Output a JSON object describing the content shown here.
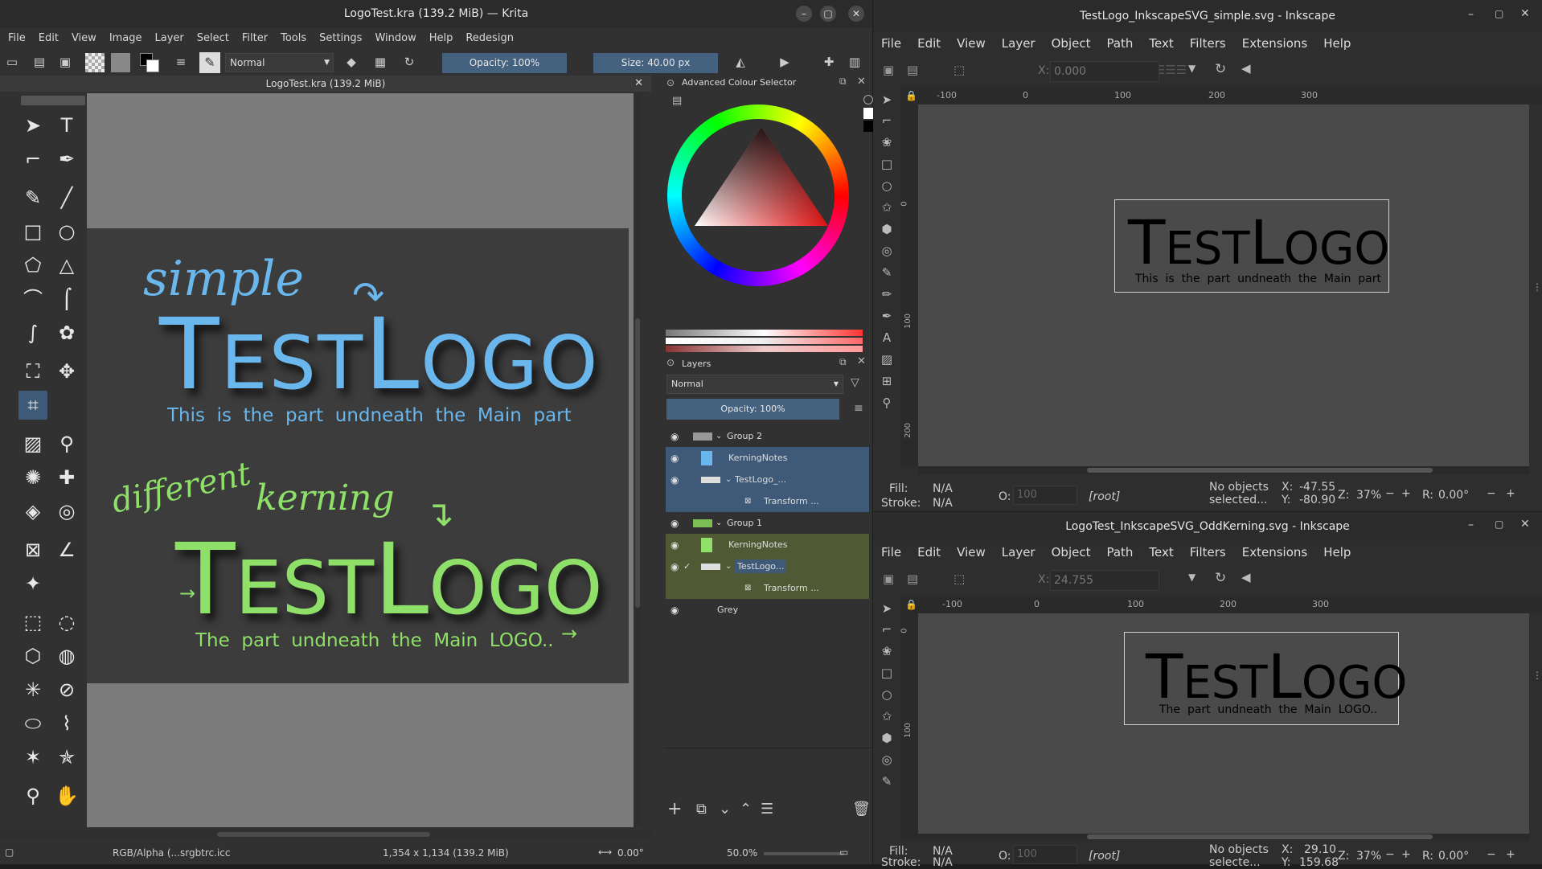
{
  "krita": {
    "title": "LogoTest.kra (139.2 MiB) — Krita",
    "menu": [
      "File",
      "Edit",
      "View",
      "Image",
      "Layer",
      "Select",
      "Filter",
      "Tools",
      "Settings",
      "Window",
      "Help",
      "Redesign"
    ],
    "blend_mode": "Normal",
    "opacity": "Opacity: 100%",
    "size": "Size: 40.00 px",
    "doc_tab": "LogoTest.kra (139.2 MiB)",
    "canvas": {
      "annot1": "simple",
      "logo1": "TESTLOGO",
      "sub1": "This  is  the  part  undneath  the  Main  part",
      "annot2a": "different",
      "annot2b": "kerning",
      "logo2": "TESTLOGO",
      "sub2": "The  part  undneath  the  Main  LOGO.."
    },
    "colour_selector_title": "Advanced Colour Selector",
    "layers_title": "Layers",
    "layers_blend": "Normal",
    "layers_opacity": "Opacity:  100%",
    "layers": [
      {
        "name": "Group 2"
      },
      {
        "name": "KerningNotes"
      },
      {
        "name": "TestLogo_..."
      },
      {
        "name": "Transform ..."
      },
      {
        "name": "Group 1"
      },
      {
        "name": "KerningNotes"
      },
      {
        "name": "TestLogo..."
      },
      {
        "name": "Transform ..."
      },
      {
        "name": "Grey"
      }
    ],
    "status": {
      "color": "RGB/Alpha (...srgbtrc.icc",
      "dims": "1,354 x 1,134 (139.2 MiB)",
      "rotation": "0.00°",
      "zoom": "50.0%"
    },
    "colors": {
      "blue": "#6ab7ee",
      "green": "#8fe068",
      "panel_sel": "#3e5a78",
      "group_green": "#4f5a34"
    }
  },
  "ink1": {
    "title": "TestLogo_InkscapeSVG_simple.svg - Inkscape",
    "menu": [
      "File",
      "Edit",
      "View",
      "Layer",
      "Object",
      "Path",
      "Text",
      "Filters",
      "Extensions",
      "Help"
    ],
    "x_field": "0.000",
    "ruler": [
      "-100",
      "0",
      "100",
      "200",
      "300"
    ],
    "vruler": [
      "0",
      "100",
      "200"
    ],
    "logo": "TESTLOGO",
    "sub": "This  is  the  part  undneath  the  Main  part",
    "fill_label": "Fill:",
    "fill": "N/A",
    "stroke_label": "Stroke:",
    "stroke": "N/A",
    "o_label": "O:",
    "o_val": "100",
    "layer": "[root]",
    "noobj": "No objects\nselected...",
    "x_label": "X:",
    "x": "-47.55",
    "y_label": "Y:",
    "y": "-80.90",
    "z_label": "Z:",
    "zoom": "37%",
    "r_label": "R:",
    "rot": "0.00°"
  },
  "ink2": {
    "title": "LogoTest_InkscapeSVG_OddKerning.svg - Inkscape",
    "menu": [
      "File",
      "Edit",
      "View",
      "Layer",
      "Object",
      "Path",
      "Text",
      "Filters",
      "Extensions",
      "Help"
    ],
    "x_field": "24.755",
    "ruler": [
      "-100",
      "0",
      "100",
      "200",
      "300"
    ],
    "vruler": [
      "0",
      "100"
    ],
    "logo": "TESTLOGO",
    "sub": "The  part  undneath  the  Main  LOGO..",
    "fill_label": "Fill:",
    "fill": "N/A",
    "stroke_label": "Stroke:",
    "stroke": "N/A",
    "o_label": "O:",
    "o_val": "100",
    "layer": "[root]",
    "noobj": "No objects\nselecte...",
    "x_label": "X:",
    "x": "29.10",
    "y_label": "Y:",
    "y": "159.68",
    "z_label": "Z:",
    "zoom": "37%",
    "r_label": "R:",
    "rot": "0.00°"
  }
}
